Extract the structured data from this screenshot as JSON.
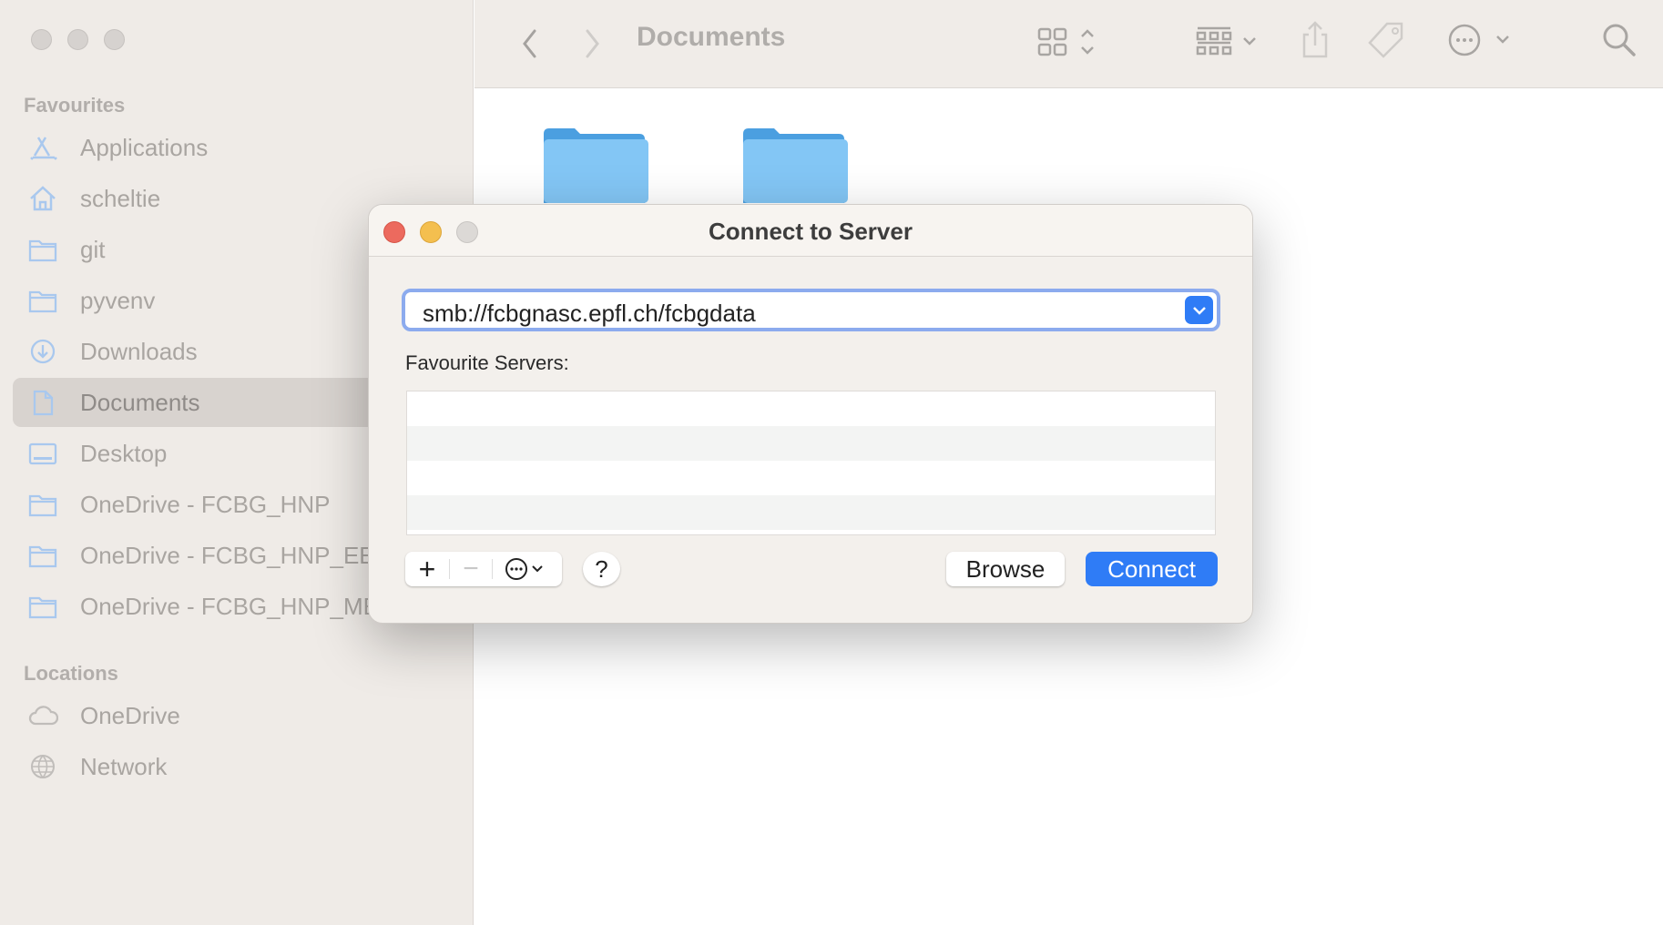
{
  "sidebar": {
    "favourites_label": "Favourites",
    "items": [
      {
        "label": "Applications",
        "icon": "applications-icon"
      },
      {
        "label": "scheltie",
        "icon": "home-icon"
      },
      {
        "label": "git",
        "icon": "folder-icon"
      },
      {
        "label": "pyvenv",
        "icon": "folder-icon"
      },
      {
        "label": "Downloads",
        "icon": "download-icon"
      },
      {
        "label": "Documents",
        "icon": "document-icon",
        "selected": true
      },
      {
        "label": "Desktop",
        "icon": "desktop-icon"
      },
      {
        "label": "OneDrive - FCBG_HNP",
        "icon": "folder-icon"
      },
      {
        "label": "OneDrive - FCBG_HNP_EEG",
        "icon": "folder-icon"
      },
      {
        "label": "OneDrive - FCBG_HNP_MEG",
        "icon": "folder-icon"
      }
    ],
    "locations_label": "Locations",
    "locations": [
      {
        "label": "OneDrive",
        "icon": "cloud-icon"
      },
      {
        "label": "Network",
        "icon": "globe-icon"
      }
    ]
  },
  "toolbar": {
    "title": "Documents"
  },
  "dialog": {
    "title": "Connect to Server",
    "server_address": "smb://fcbgnasc.epfl.ch/fcbgdata",
    "favourites_label": "Favourite Servers:",
    "favourite_servers": [],
    "add_label": "+",
    "remove_label": "−",
    "help_label": "?",
    "browse_label": "Browse",
    "connect_label": "Connect",
    "accent": "#2f7cf6"
  }
}
